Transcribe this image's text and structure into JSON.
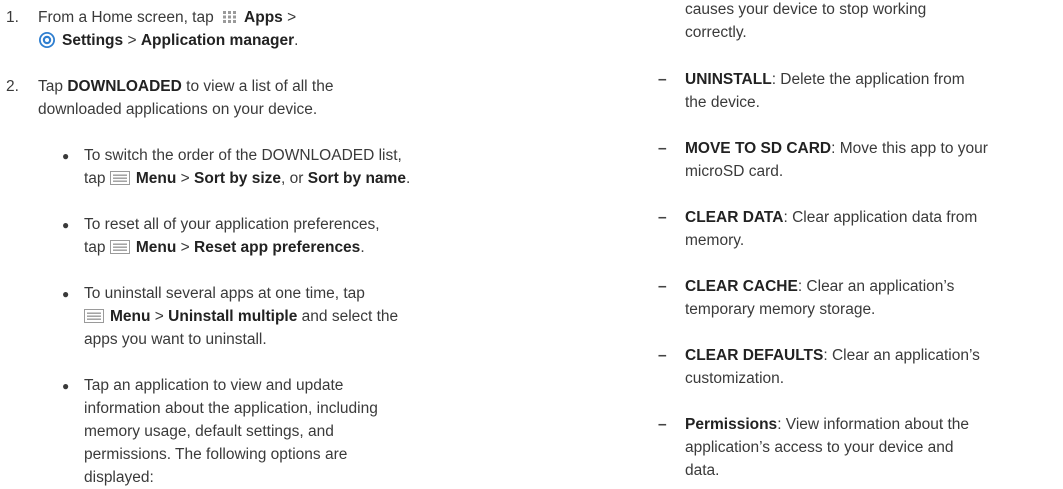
{
  "left": {
    "step1": {
      "num": "1.",
      "line1_pre": "From a Home screen, tap",
      "line1_apps": "Apps",
      "line1_post": ">",
      "line2_settings": "Settings",
      "line2_mid": ">",
      "line2_manager": "Application manager",
      "line2_end": "."
    },
    "step2": {
      "num": "2.",
      "line1_pre": "Tap",
      "line1_bold": "DOWNLOADED",
      "line1_post": "to view a list of all the",
      "line2": "downloaded applications on your device."
    },
    "bullets": [
      {
        "l1": "To switch the order of the DOWNLOADED list,",
        "l2_pre": "tap",
        "menu": "Menu",
        "gt": ">",
        "b1": "Sort by size",
        "mid": ", or",
        "b2": "Sort by name",
        "end": "."
      },
      {
        "l1": "To reset all of your application preferences,",
        "l2_pre": "tap",
        "menu": "Menu",
        "gt": ">",
        "b1": "Reset app preferences",
        "end": "."
      },
      {
        "l1": "To uninstall several apps at one time, tap",
        "menu": "Menu",
        "gt": ">",
        "b1": "Uninstall multiple",
        "post": "and select the",
        "l3": "apps you want to uninstall."
      },
      {
        "l1": "Tap an application to view and update",
        "l2": "information about the application, including",
        "l3": "memory usage, default settings, and",
        "l4": "permissions. The following options are",
        "l5": "displayed:"
      }
    ],
    "bullet_glyph": "●"
  },
  "right": {
    "top_l1": "causes your device to stop working",
    "top_l2": "correctly.",
    "dash_glyph": "–",
    "options": [
      {
        "bold": "UNINSTALL",
        "rest": ": Delete the application from",
        "l2": "the device."
      },
      {
        "bold": "MOVE TO SD CARD",
        "rest": ": Move this app to your",
        "l2": "microSD card."
      },
      {
        "bold": "CLEAR DATA",
        "rest": ": Clear application data from",
        "l2": "memory."
      },
      {
        "bold": "CLEAR CACHE",
        "rest": ": Clear an application’s",
        "l2": "temporary memory storage."
      },
      {
        "bold": "CLEAR DEFAULTS",
        "rest": ": Clear an application’s",
        "l2": "customization."
      },
      {
        "bold": "Permissions",
        "rest": ": View information about the",
        "l2": "application’s access to your device and",
        "l3": "data."
      }
    ]
  },
  "icons": {
    "apps": "apps-grid-icon",
    "settings": "settings-gear-icon",
    "menu": "menu-icon"
  },
  "colors": {
    "text": "#3a3a3a",
    "bold": "#222222",
    "icon_gray": "#9a9a9a",
    "gear_blue": "#2f7fd0"
  }
}
